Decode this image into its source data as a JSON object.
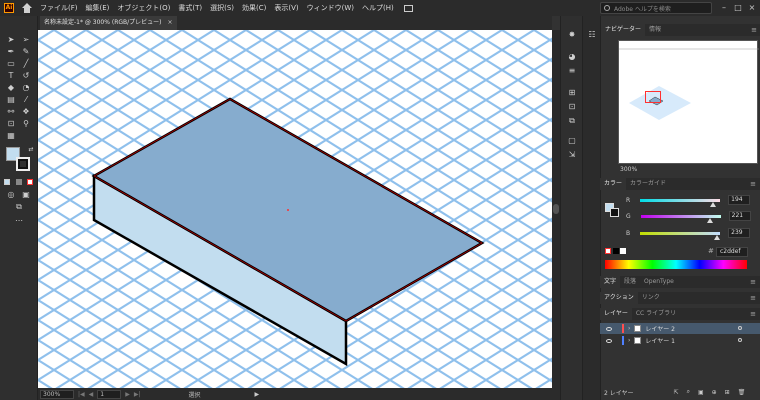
{
  "menubar": {
    "logo": "Ai",
    "items": [
      "ファイル(F)",
      "編集(E)",
      "オブジェクト(O)",
      "書式(T)",
      "選択(S)",
      "効果(C)",
      "表示(V)",
      "ウィンドウ(W)",
      "ヘルプ(H)"
    ],
    "search_placeholder": "Adobe ヘルプを検索"
  },
  "document": {
    "tab_title": "名称未設定-1* @ 300% (RGB/プレビュー)",
    "close_label": "×"
  },
  "statusbar": {
    "zoom": "300%",
    "page": "1",
    "status": "選択"
  },
  "navigator": {
    "tabs": [
      "ナビゲーター",
      "情報"
    ],
    "zoom": "300%"
  },
  "color": {
    "tabs": [
      "カラー",
      "カラーガイド"
    ],
    "r_label": "R",
    "r_value": "194",
    "g_label": "G",
    "g_value": "221",
    "b_label": "B",
    "b_value": "239",
    "hex": "c2ddef",
    "fill_color": "#c2ddef"
  },
  "type_panel": {
    "tabs": [
      "文字",
      "段落",
      "OpenType"
    ]
  },
  "actions_panel": {
    "tabs": [
      "アクション",
      "リンク"
    ]
  },
  "layers_panel": {
    "tabs": [
      "レイヤー",
      "CC ライブラリ"
    ],
    "layers": [
      {
        "name": "レイヤー 2",
        "color": "#ff4e4e",
        "selected": true
      },
      {
        "name": "レイヤー 1",
        "color": "#4f80ff",
        "selected": false
      }
    ],
    "footer": "2 レイヤー"
  },
  "canvas": {
    "grid_color": "#8fc0ec",
    "top_face_color": "#86acce",
    "side_face_color": "#c2ddef"
  }
}
